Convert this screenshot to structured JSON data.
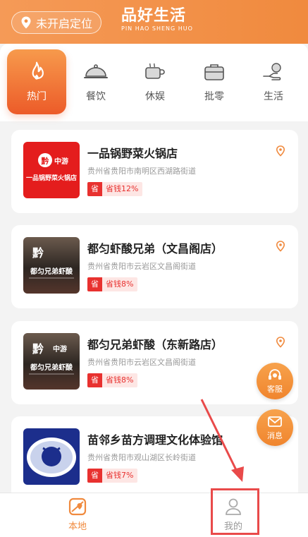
{
  "header": {
    "location_label": "未开启定位",
    "brand_cn": "品好生活",
    "brand_en": "PIN HAO SHENG HUO"
  },
  "categories": [
    {
      "label": "热门",
      "icon": "fire-icon",
      "active": true
    },
    {
      "label": "餐饮",
      "icon": "dish-cover-icon",
      "active": false
    },
    {
      "label": "休娱",
      "icon": "coffee-cup-icon",
      "active": false
    },
    {
      "label": "批零",
      "icon": "toolbox-icon",
      "active": false
    },
    {
      "label": "生活",
      "icon": "hand-money-icon",
      "active": false
    }
  ],
  "shops": [
    {
      "name": "一品锅野菜火锅店",
      "address": "贵州省贵阳市南明区西湖路街道",
      "tag": "省",
      "saving": "省钱12%",
      "thumb_text_top": "黔中游",
      "thumb_text_main": "一品锅野菜火锅店"
    },
    {
      "name": "都匀虾酸兄弟（文昌阁店）",
      "address": "贵州省贵阳市云岩区文昌阁街道",
      "tag": "省",
      "saving": "省钱8%",
      "thumb_text_top": "黔",
      "thumb_text_main": "都匀兄弟虾酸"
    },
    {
      "name": "都匀兄弟虾酸（东新路店）",
      "address": "贵州省贵阳市云岩区文昌阁街道",
      "tag": "省",
      "saving": "省钱8%",
      "thumb_text_top": "黔中游",
      "thumb_text_main": "都匀兄弟虾酸"
    },
    {
      "name": "苗邻乡苗方调理文化体验馆",
      "address": "贵州省贵阳市观山湖区长岭街道",
      "tag": "省",
      "saving": "省钱7%"
    }
  ],
  "fabs": {
    "service_label": "客服",
    "message_label": "消息"
  },
  "tabbar": {
    "home_label": "本地",
    "me_label": "我的"
  },
  "colors": {
    "accent": "#f08a3e",
    "saving_red": "#e8312f",
    "annotation": "#e94a4a"
  }
}
